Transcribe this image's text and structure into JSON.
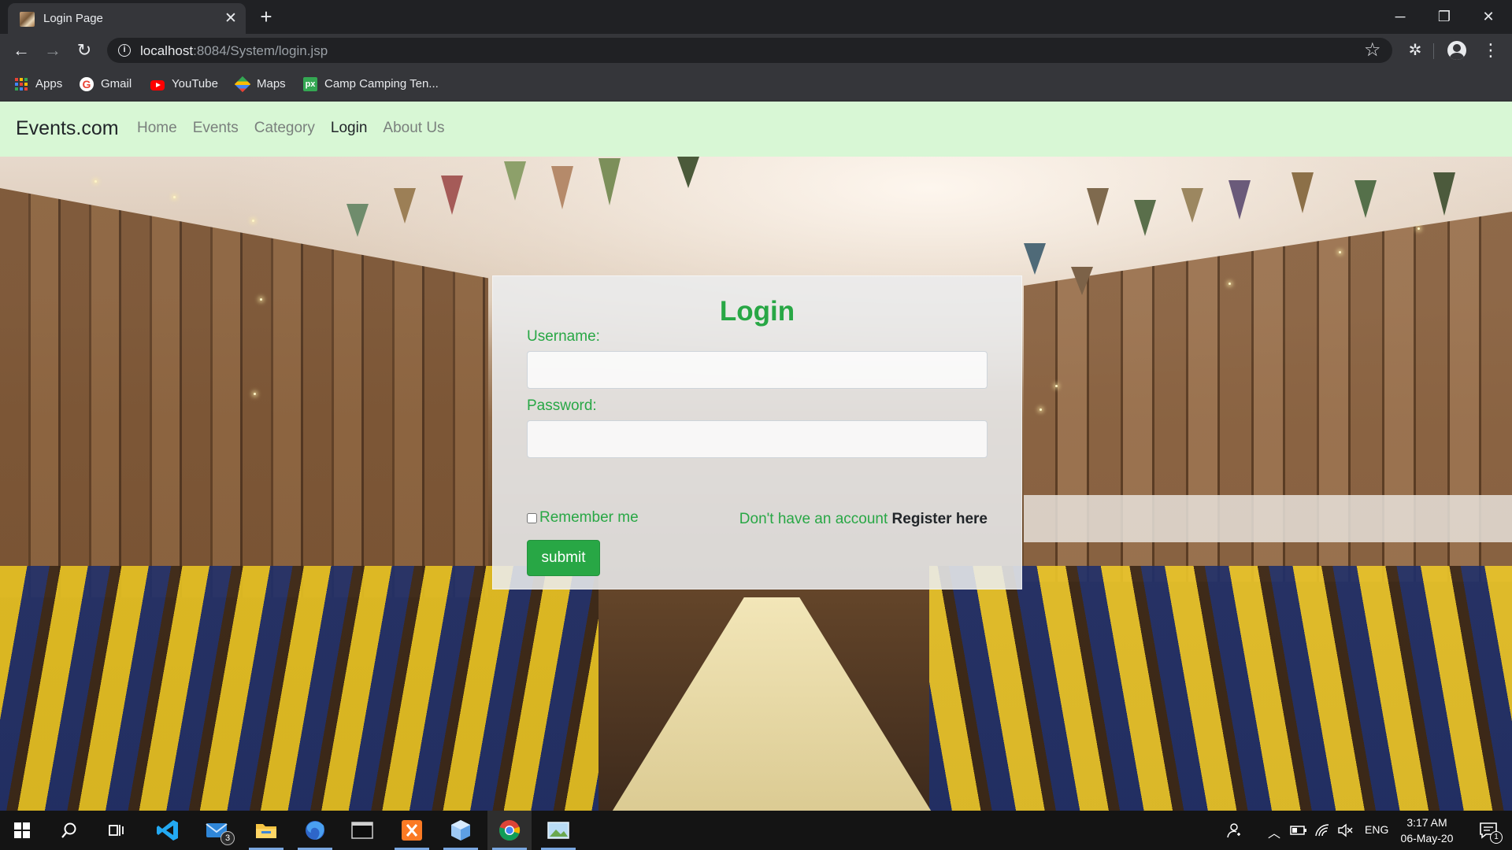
{
  "browser": {
    "tab_title": "Login Page",
    "url_host": "localhost",
    "url_path": ":8084/System/login.jsp",
    "bookmarks": [
      {
        "label": "Apps",
        "icon": "apps-icon"
      },
      {
        "label": "Gmail",
        "icon": "gmail-icon"
      },
      {
        "label": "YouTube",
        "icon": "youtube-icon"
      },
      {
        "label": "Maps",
        "icon": "maps-icon"
      },
      {
        "label": "Camp Camping Ten...",
        "icon": "px-icon"
      }
    ]
  },
  "site": {
    "brand": "Events.com",
    "nav": [
      "Home",
      "Events",
      "Category",
      "Login",
      "About Us"
    ],
    "active_nav": "Login"
  },
  "login": {
    "title": "Login",
    "username_label": "Username:",
    "username_value": "",
    "password_label": "Password:",
    "password_value": "",
    "remember_label": "Remember me",
    "remember_checked": false,
    "register_prompt": "Don't have an account",
    "register_link": "Register here",
    "submit_label": "submit"
  },
  "taskbar": {
    "mail_badge": "3",
    "language": "ENG",
    "time": "3:17 AM",
    "date": "06-May-20",
    "notification_count": "1"
  },
  "colors": {
    "accent_green": "#28a745",
    "navbar_bg": "#d8f7d5",
    "chrome_dark": "#202124"
  }
}
